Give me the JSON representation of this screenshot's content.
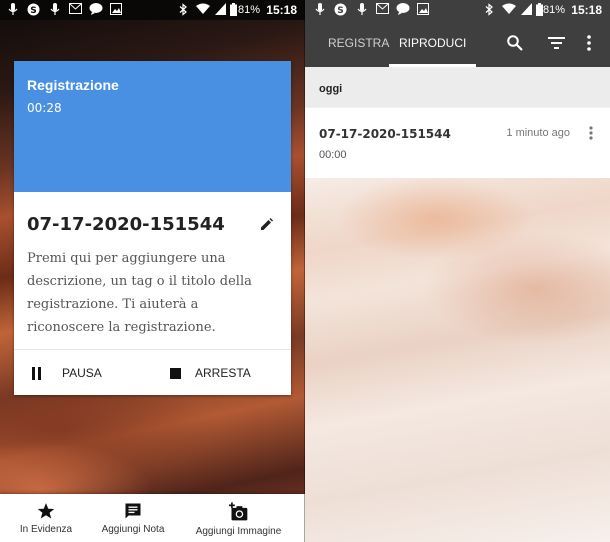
{
  "status_left": {
    "battery": "81%",
    "time": "15:18"
  },
  "status_right": {
    "battery": "81%",
    "time": "15:18"
  },
  "recording_card": {
    "header_title": "Registrazione",
    "elapsed": "00:28",
    "name": "07-17-2020-151544",
    "description": "Premi qui per aggiungere una descrizione, un tag o il titolo della registrazione. Ti aiuterà a riconoscere la registrazione.",
    "pause_label": "PAUSA",
    "stop_label": "ARRESTA"
  },
  "bottom_bar": {
    "items": [
      {
        "label": "In Evidenza",
        "icon": "star-icon"
      },
      {
        "label": "Aggiungi Nota",
        "icon": "note-icon"
      },
      {
        "label": "Aggiungi Immagine",
        "icon": "add-photo-icon"
      }
    ]
  },
  "right_app": {
    "tabs": [
      {
        "label": "REGISTRA",
        "active": false
      },
      {
        "label": "RIPRODUCI",
        "active": true
      }
    ],
    "section_header": "oggi",
    "recordings": [
      {
        "name": "07-17-2020-151544",
        "duration": "00:00",
        "ago": "1 minuto ago"
      }
    ]
  },
  "colors": {
    "card_header": "#4a90e2",
    "toolbar": "#3f3f3f"
  }
}
